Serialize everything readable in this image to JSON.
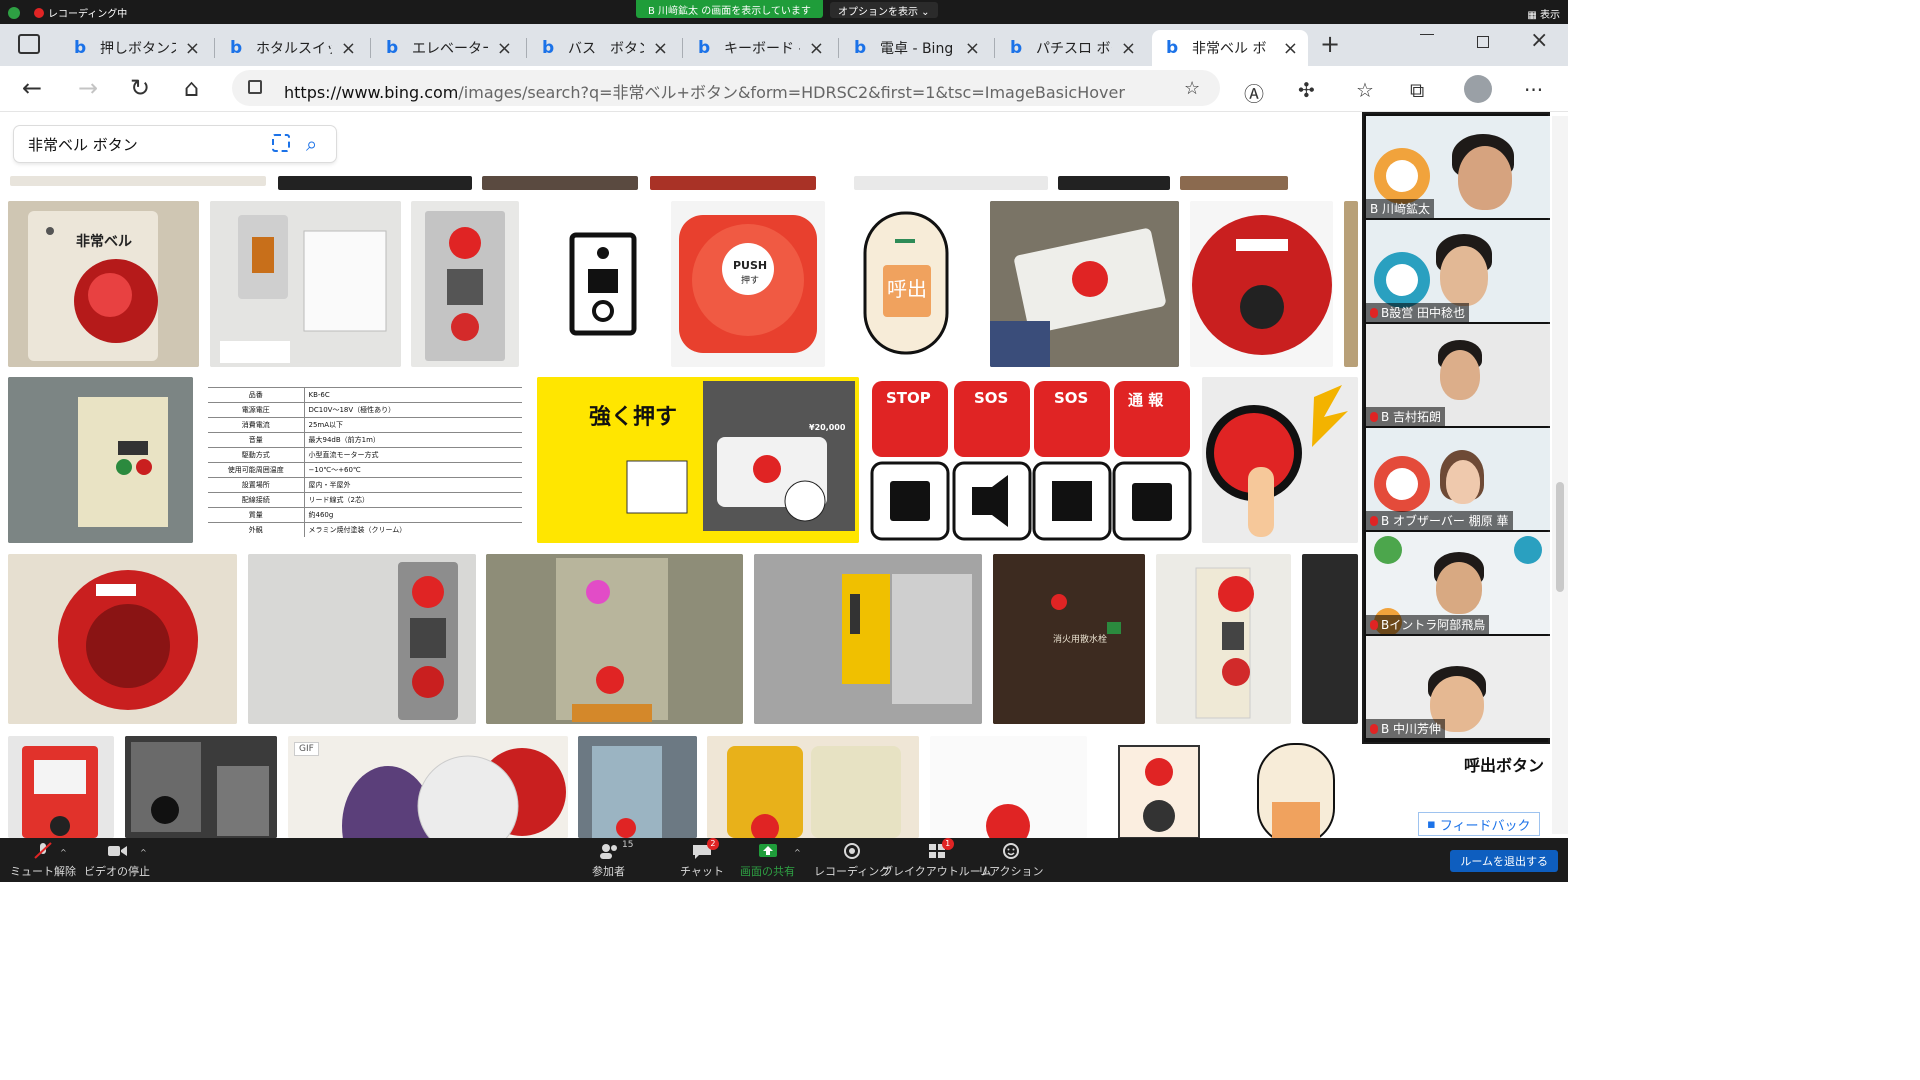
{
  "zoom_top": {
    "recording_label": "レコーディング中",
    "sharing_banner": "B 川﨑鉱太 の画面を表示しています",
    "options_label": "オプションを表示 ⌄",
    "view_label": "表示"
  },
  "browser": {
    "tabs": [
      {
        "title": "押しボタンス"
      },
      {
        "title": "ホタルスイッチ"
      },
      {
        "title": "エレベーター"
      },
      {
        "title": "バス　ボタン"
      },
      {
        "title": "キーボード - B"
      },
      {
        "title": "電卓 - Bing"
      },
      {
        "title": "パチスロ ボタ"
      },
      {
        "title": "非常ベル ボ"
      }
    ],
    "url_host": "https://www.bing.com",
    "url_path": "/images/search?q=非常ベル+ボタン&form=HDRSC2&first=1&tsc=ImageBasicHover"
  },
  "search": {
    "query": "非常ベル ボタン"
  },
  "images": {
    "label_hijo_bell": "非常ベル",
    "push_label": "PUSH",
    "push_sub": "押す",
    "call_label": "呼出",
    "strong_push": "強く押す",
    "price": "¥20,000",
    "spec_rows": [
      [
        "品番",
        "KB-6C"
      ],
      [
        "電源電圧",
        "DC10V〜18V（極性あり）"
      ],
      [
        "消費電流",
        "25mA以下"
      ],
      [
        "音量",
        "最大94dB（前方1m）"
      ],
      [
        "駆動方式",
        "小型直流モーター方式"
      ],
      [
        "使用可能周囲温度",
        "−10℃〜+60℃"
      ],
      [
        "設置場所",
        "屋内・半屋外"
      ],
      [
        "配線接続",
        "リード線式（2芯）"
      ],
      [
        "質量",
        "約460g"
      ],
      [
        "外観",
        "メラミン焼付塗装（クリーム）"
      ]
    ],
    "stop": "STOP",
    "sos": "SOS",
    "tsuho": "通 報",
    "gif": "GIF",
    "fire_hydrant": "消火用散水栓"
  },
  "participants": [
    {
      "name": "B 川﨑鉱太"
    },
    {
      "name": "B設営 田中稔也"
    },
    {
      "name": "B 吉村拓朗"
    },
    {
      "name": "B オブザーバー 棚原 華"
    },
    {
      "name": "Bイントラ阿部飛鳥"
    },
    {
      "name": "B 中川芳伸"
    }
  ],
  "right_label": "呼出ボタン",
  "feedback": "フィードバック",
  "zoom_bar": {
    "mute": "ミュート解除",
    "video": "ビデオの停止",
    "participants": "参加者",
    "participants_count": "15",
    "chat": "チャット",
    "chat_badge": "2",
    "share": "画面の共有",
    "record": "レコーディング",
    "breakout": "ブレイクアウトルーム",
    "breakout_badge": "1",
    "reactions": "リアクション",
    "leave": "ルームを退出する"
  },
  "colors": {
    "bing_blue": "#1b72e8",
    "zoom_green": "#1f9d3a",
    "alarm_red": "#e02424"
  }
}
